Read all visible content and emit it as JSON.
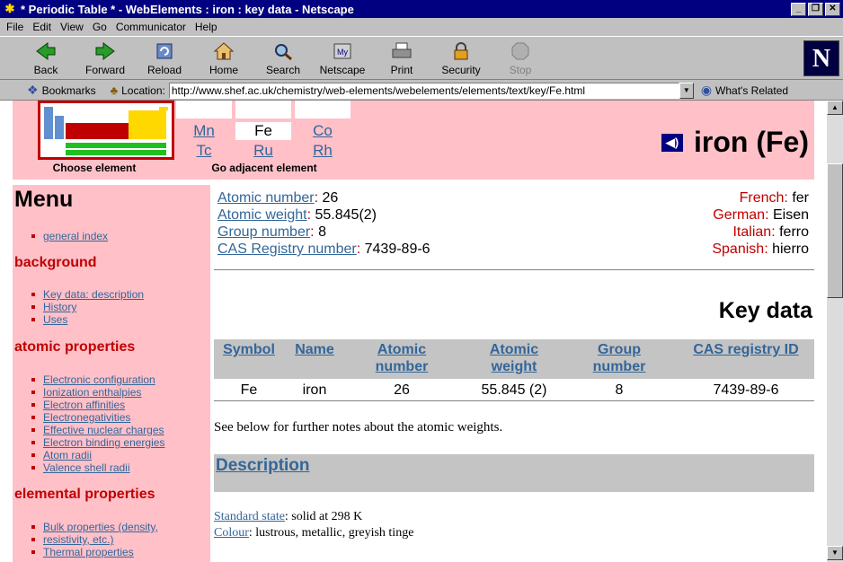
{
  "window": {
    "title": "* Periodic Table * - WebElements : iron : key data - Netscape",
    "controls": [
      "_",
      "❐",
      "✕"
    ]
  },
  "menubar": [
    "File",
    "Edit",
    "View",
    "Go",
    "Communicator",
    "Help"
  ],
  "toolbar": [
    {
      "label": "Back",
      "icon": "back-arrow-icon"
    },
    {
      "label": "Forward",
      "icon": "forward-arrow-icon"
    },
    {
      "label": "Reload",
      "icon": "reload-icon"
    },
    {
      "label": "Home",
      "icon": "home-icon"
    },
    {
      "label": "Search",
      "icon": "search-icon"
    },
    {
      "label": "Netscape",
      "icon": "netscape-icon"
    },
    {
      "label": "Print",
      "icon": "print-icon"
    },
    {
      "label": "Security",
      "icon": "lock-icon"
    },
    {
      "label": "Stop",
      "icon": "stop-icon"
    }
  ],
  "logo": "N",
  "locationbar": {
    "bookmarks_label": "Bookmarks",
    "location_label": "Location:",
    "url": "http://www.shef.ac.uk/chemistry/web-elements/webelements/elements/text/key/Fe.html",
    "related_label": "What's Related"
  },
  "header": {
    "choose_label": "Choose element",
    "adjacent_label": "Go adjacent element",
    "adjacent": {
      "top": [
        "",
        "",
        ""
      ],
      "middle": [
        "Mn",
        "Fe",
        "Co"
      ],
      "bottom": [
        "Tc",
        "Ru",
        "Rh"
      ]
    },
    "element_title": "iron (Fe)"
  },
  "menu": {
    "title": "Menu",
    "top_items": [
      "general index"
    ],
    "sections": [
      {
        "title": "background",
        "items": [
          "Key data: description",
          "History",
          "Uses"
        ]
      },
      {
        "title": "atomic properties",
        "items": [
          "Electronic configuration",
          "Ionization enthalpies",
          "Electron affinities",
          "Electronegativities",
          "Effective nuclear charges",
          "Electron binding energies",
          "Atom radii",
          "Valence shell radii"
        ]
      },
      {
        "title": "elemental properties",
        "items": [
          "Bulk properties (density,",
          "resistivity, etc.)",
          "Thermal properties"
        ]
      }
    ]
  },
  "info": {
    "atomic_number_label": "Atomic number",
    "atomic_number": "26",
    "atomic_weight_label": "Atomic weight",
    "atomic_weight": "55.845(2)",
    "group_number_label": "Group number",
    "group_number": "8",
    "cas_label": "CAS Registry number",
    "cas": "7439-89-6",
    "names": [
      {
        "lang": "French",
        "name": "fer"
      },
      {
        "lang": "German",
        "name": "Eisen"
      },
      {
        "lang": "Italian",
        "name": "ferro"
      },
      {
        "lang": "Spanish",
        "name": "hierro"
      }
    ]
  },
  "keydata": {
    "heading": "Key data",
    "columns": [
      "Symbol",
      "Name",
      "Atomic number",
      "Atomic weight",
      "Group number",
      "CAS registry ID"
    ],
    "row": [
      "Fe",
      "iron",
      "26",
      "55.845 (2)",
      "8",
      "7439-89-6"
    ],
    "note": "See below for further notes about the atomic weights."
  },
  "description": {
    "heading": "Description",
    "standard_state_label": "Standard state",
    "standard_state": ": solid at 298 K",
    "colour_label": "Colour",
    "colour": ": lustrous, metallic, greyish tinge"
  },
  "colors": {
    "pink": "#ffc0c8",
    "red": "#c00000",
    "link": "#336699",
    "grey_band": "#c4c4c4"
  }
}
